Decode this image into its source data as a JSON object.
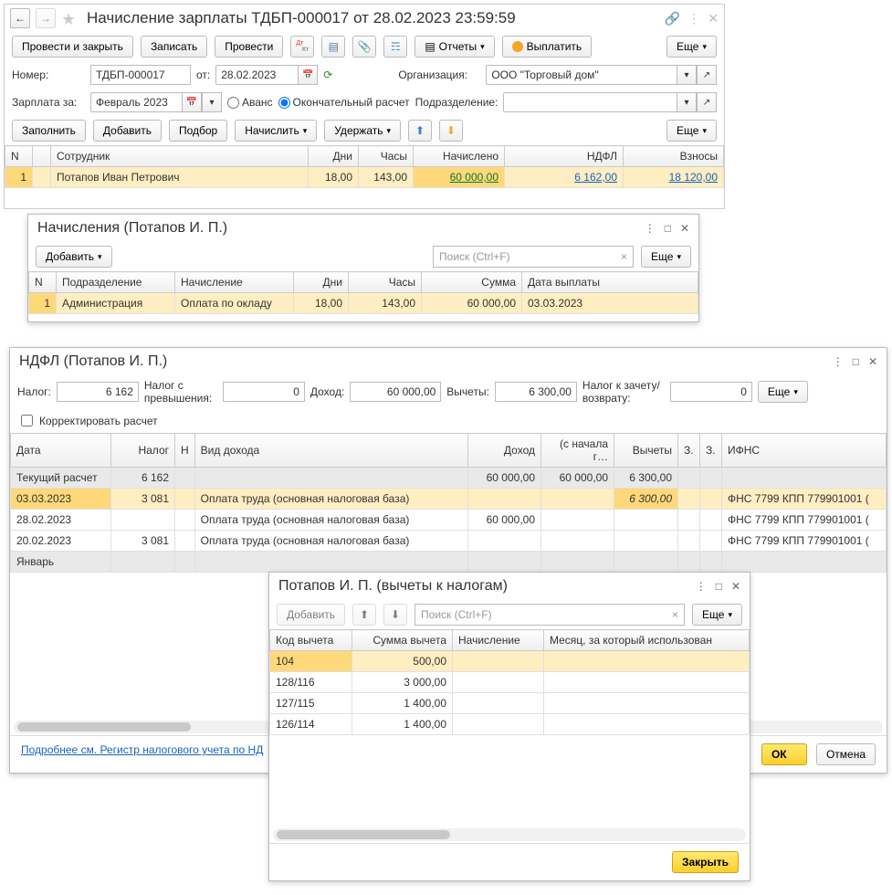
{
  "doc": {
    "title": "Начисление зарплаты ТДБП-000017 от 28.02.2023 23:59:59",
    "number_label": "Номер:",
    "number": "ТДБП-000017",
    "from_label": "от:",
    "date": "28.02.2023",
    "org_label": "Организация:",
    "org": "ООО \"Торговый дом\"",
    "period_label": "Зарплата за:",
    "period": "Февраль 2023",
    "radio_advance": "Аванс",
    "radio_final": "Окончательный расчет",
    "dept_label": "Подразделение:"
  },
  "toolbar": {
    "post_close": "Провести и закрыть",
    "save": "Записать",
    "post": "Провести",
    "reports": "Отчеты",
    "pay": "Выплатить",
    "more": "Еще",
    "fill": "Заполнить",
    "add": "Добавить",
    "pick": "Подбор",
    "accrue": "Начислить",
    "deduct": "Удержать"
  },
  "main_table": {
    "headers": [
      "N",
      "",
      "Сотрудник",
      "Дни",
      "Часы",
      "Начислено",
      "НДФЛ",
      "Взносы"
    ],
    "row": {
      "n": "1",
      "emp": "Потапов Иван Петрович",
      "days": "18,00",
      "hours": "143,00",
      "accrued": "60 000,00",
      "ndfl": "6 162,00",
      "contrib": "18 120,00"
    }
  },
  "accruals": {
    "title": "Начисления (Потапов И. П.)",
    "add": "Добавить",
    "search_ph": "Поиск (Ctrl+F)",
    "more": "Еще",
    "headers": [
      "N",
      "Подразделение",
      "Начисление",
      "Дни",
      "Часы",
      "Сумма",
      "Дата выплаты"
    ],
    "row": {
      "n": "1",
      "dept": "Администрация",
      "acc": "Оплата по окладу",
      "days": "18,00",
      "hours": "143,00",
      "sum": "60 000,00",
      "date": "03.03.2023"
    }
  },
  "ndfl": {
    "title": "НДФЛ (Потапов И. П.)",
    "tax_label": "Налог:",
    "tax": "6 162",
    "excess_label": "Налог с превышения:",
    "excess": "0",
    "income_label": "Доход:",
    "income": "60 000,00",
    "deduct_label": "Вычеты:",
    "deduct": "6 300,00",
    "credit_label": "Налог к зачету/возврату:",
    "credit": "0",
    "more": "Еще",
    "correct_label": "Корректировать расчет",
    "headers": [
      "Дата",
      "Налог",
      "Н",
      "Вид дохода",
      "Доход",
      "(с начала г…",
      "Вычеты",
      "З.",
      "З.",
      "ИФНС"
    ],
    "rows": [
      {
        "date": "Текущий расчет",
        "tax": "6 162",
        "kind": "",
        "income": "60 000,00",
        "ytd": "60 000,00",
        "ded": "6 300,00",
        "ifns": "",
        "gray": true
      },
      {
        "date": "03.03.2023",
        "tax": "3 081",
        "kind": "Оплата труда (основная налоговая база)",
        "income": "",
        "ytd": "",
        "ded": "6 300,00",
        "ifns": "ФНС 7799 КПП 779901001 (",
        "hi": true
      },
      {
        "date": "28.02.2023",
        "tax": "",
        "kind": "Оплата труда (основная налоговая база)",
        "income": "60 000,00",
        "ytd": "",
        "ded": "",
        "ifns": "ФНС 7799 КПП 779901001 ("
      },
      {
        "date": "20.02.2023",
        "tax": "3 081",
        "kind": "Оплата труда (основная налоговая база)",
        "income": "",
        "ytd": "",
        "ded": "",
        "ifns": "ФНС 7799 КПП 779901001 ("
      },
      {
        "date": "Январь",
        "tax": "",
        "kind": "",
        "income": "",
        "ytd": "",
        "ded": "",
        "ifns": "",
        "gray": true
      }
    ],
    "footer_link": "Подробнее см. Регистр налогового учета по НД",
    "ok": "ОК",
    "cancel": "Отмена"
  },
  "ded_popup": {
    "title": "Потапов И. П. (вычеты к налогам)",
    "add": "Добавить",
    "search_ph": "Поиск (Ctrl+F)",
    "more": "Еще",
    "headers": [
      "Код вычета",
      "Сумма вычета",
      "Начисление",
      "Месяц, за который использован"
    ],
    "rows": [
      {
        "code": "104",
        "sum": "500,00"
      },
      {
        "code": "128/116",
        "sum": "3 000,00"
      },
      {
        "code": "127/115",
        "sum": "1 400,00"
      },
      {
        "code": "126/114",
        "sum": "1 400,00"
      }
    ],
    "close": "Закрыть"
  }
}
